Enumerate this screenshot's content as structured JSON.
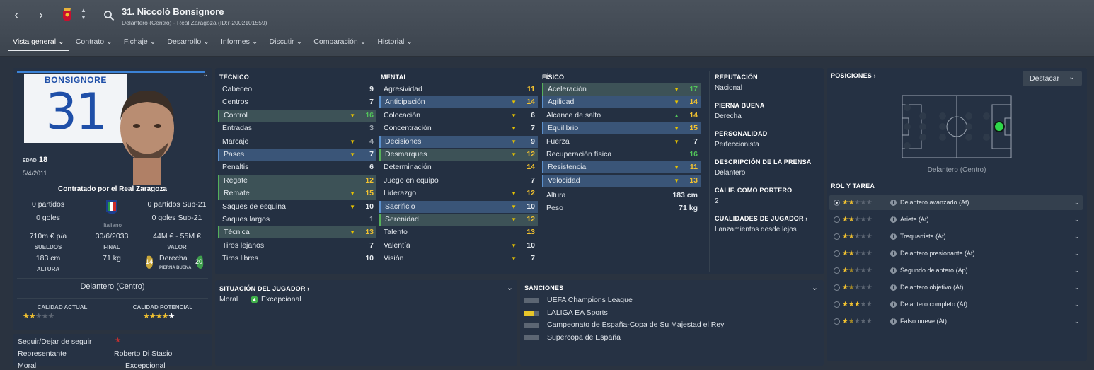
{
  "header": {
    "title": "31. Niccolò Bonsignore",
    "subtitle": "Delantero (Centro) - Real Zaragoza (ID:r-2002101559)",
    "back_glyph": "‹",
    "forward_glyph": "›"
  },
  "tabs": [
    {
      "label": "Vista general ⌄"
    },
    {
      "label": "Contrato ⌄"
    },
    {
      "label": "Fichaje ⌄"
    },
    {
      "label": "Desarrollo ⌄"
    },
    {
      "label": "Informes ⌄"
    },
    {
      "label": "Discutir ⌄"
    },
    {
      "label": "Comparación ⌄"
    },
    {
      "label": "Historial ⌄"
    }
  ],
  "profile": {
    "shirt_name": "BONSIGNORE",
    "shirt_number": "31",
    "age_label": "EDAD",
    "age": "18",
    "dob": "5/4/2011",
    "contracted_by": "Contratado por el Real Zaragoza",
    "apps": "0 partidos",
    "goals": "0 goles",
    "apps_u21": "0 partidos Sub-21",
    "goals_u21": "0 goles Sub-21",
    "nationality": "Italiano",
    "wage": "710m € p/a",
    "wage_label": "SUELDOS",
    "contract_end": "30/6/2033",
    "contract_end_label": "FINAL",
    "value": "44M € - 55M €",
    "value_label": "VALOR",
    "height": "183 cm",
    "height_label": "ALTURA",
    "weight": "71 kg",
    "foot": "Derecha",
    "foot_label": "PIERNA BUENA",
    "left_foot_rating": "14",
    "right_foot_rating": "20",
    "position": "Delantero (Centro)",
    "current_ability_label": "CALIDAD ACTUAL",
    "current_ability_stars": 2,
    "potential_ability_label": "CALIDAD POTENCIAL",
    "potential_ability_stars": 4,
    "star_glyphs": {
      "c": "★★☆☆☆",
      "p": "★★★★★"
    }
  },
  "extra": {
    "follow": "Seguir/Dejar de seguir",
    "follow_mark": "★",
    "agent_label": "Representante",
    "agent": "Roberto Di Stasio",
    "morale_label": "Moral",
    "morale": "Excepcional"
  },
  "attributes": {
    "tecnico_label": "TÉCNICO",
    "mental_label": "MENTAL",
    "fisico_label": "FÍSICO",
    "tecnico": [
      {
        "name": "Cabeceo",
        "value": "9",
        "arrow": ""
      },
      {
        "name": "Centros",
        "value": "7",
        "arrow": ""
      },
      {
        "name": "Control",
        "value": "16",
        "arrow": "▼"
      },
      {
        "name": "Entradas",
        "value": "3",
        "arrow": ""
      },
      {
        "name": "Marcaje",
        "value": "4",
        "arrow": "▼"
      },
      {
        "name": "Pases",
        "value": "7",
        "arrow": "▼"
      },
      {
        "name": "Penaltis",
        "value": "6",
        "arrow": ""
      },
      {
        "name": "Regate",
        "value": "12",
        "arrow": ""
      },
      {
        "name": "Remate",
        "value": "15",
        "arrow": "▼"
      },
      {
        "name": "Saques de esquina",
        "value": "10",
        "arrow": "▼"
      },
      {
        "name": "Saques largos",
        "value": "1",
        "arrow": ""
      },
      {
        "name": "Técnica",
        "value": "13",
        "arrow": "▼"
      },
      {
        "name": "Tiros lejanos",
        "value": "7",
        "arrow": ""
      },
      {
        "name": "Tiros libres",
        "value": "10",
        "arrow": ""
      }
    ],
    "mental": [
      {
        "name": "Agresividad",
        "value": "11",
        "arrow": ""
      },
      {
        "name": "Anticipación",
        "value": "14",
        "arrow": "▼"
      },
      {
        "name": "Colocación",
        "value": "6",
        "arrow": "▼"
      },
      {
        "name": "Concentración",
        "value": "7",
        "arrow": "▼"
      },
      {
        "name": "Decisiones",
        "value": "9",
        "arrow": "▼"
      },
      {
        "name": "Desmarques",
        "value": "12",
        "arrow": "▼"
      },
      {
        "name": "Determinación",
        "value": "14",
        "arrow": ""
      },
      {
        "name": "Juego en equipo",
        "value": "7",
        "arrow": ""
      },
      {
        "name": "Liderazgo",
        "value": "12",
        "arrow": "▼"
      },
      {
        "name": "Sacrificio",
        "value": "10",
        "arrow": "▼"
      },
      {
        "name": "Serenidad",
        "value": "12",
        "arrow": "▼"
      },
      {
        "name": "Talento",
        "value": "13",
        "arrow": ""
      },
      {
        "name": "Valentía",
        "value": "10",
        "arrow": "▼"
      },
      {
        "name": "Visión",
        "value": "7",
        "arrow": "▼"
      }
    ],
    "fisico": [
      {
        "name": "Aceleración",
        "value": "17",
        "arrow": "▼"
      },
      {
        "name": "Agilidad",
        "value": "14",
        "arrow": "▼"
      },
      {
        "name": "Alcance de salto",
        "value": "14",
        "arrow": "▲"
      },
      {
        "name": "Equilibrio",
        "value": "15",
        "arrow": "▼"
      },
      {
        "name": "Fuerza",
        "value": "7",
        "arrow": "▼"
      },
      {
        "name": "Recuperación física",
        "value": "16",
        "arrow": ""
      },
      {
        "name": "Resistencia",
        "value": "11",
        "arrow": "▼"
      },
      {
        "name": "Velocidad",
        "value": "13",
        "arrow": "▼"
      }
    ],
    "altura_label": "Altura",
    "altura": "183 cm",
    "peso_label": "Peso",
    "peso": "71 kg"
  },
  "info": {
    "reputation_label": "REPUTACIÓN",
    "reputation": "Nacional",
    "foot_label": "PIERNA BUENA",
    "foot": "Derecha",
    "personality_label": "PERSONALIDAD",
    "personality": "Perfeccionista",
    "press_label": "DESCRIPCIÓN DE LA PRENSA",
    "press": "Delantero",
    "gk_label": "CALIF. COMO PORTERO",
    "gk": "2",
    "traits_label": "CUALIDADES DE JUGADOR ›",
    "traits": "Lanzamientos desde lejos"
  },
  "status": {
    "label": "SITUACIÓN DEL JUGADOR ›",
    "morale_label": "Moral",
    "morale": "Excepcional"
  },
  "sanctions": {
    "label": "SANCIONES",
    "items": [
      {
        "name": "UEFA Champions League",
        "yellow": 0
      },
      {
        "name": "LALIGA EA Sports",
        "yellow": 2
      },
      {
        "name": "Campeonato de España-Copa de Su Majestad el Rey",
        "yellow": 0
      },
      {
        "name": "Supercopa de España",
        "yellow": 0
      }
    ]
  },
  "positions": {
    "label": "POSICIONES ›",
    "highlight_button": "Destacar",
    "position_name": "Delantero (Centro)",
    "role_label": "ROL Y TAREA",
    "roles": [
      {
        "name": "Delantero avanzado (At)",
        "stars": "★★☆☆☆",
        "selected": true
      },
      {
        "name": "Ariete (At)",
        "stars": "★★☆☆☆",
        "selected": false
      },
      {
        "name": "Trequartista (At)",
        "stars": "★★☆☆☆",
        "selected": false
      },
      {
        "name": "Delantero presionante (At)",
        "stars": "★★☆☆☆",
        "selected": false
      },
      {
        "name": "Segundo delantero (Ap)",
        "stars": "★½☆☆☆",
        "selected": false
      },
      {
        "name": "Delantero objetivo (At)",
        "stars": "★½☆☆☆",
        "selected": false
      },
      {
        "name": "Delantero completo (At)",
        "stars": "★★★☆☆",
        "selected": false
      },
      {
        "name": "Falso nueve (At)",
        "stars": "★½☆☆☆",
        "selected": false
      }
    ]
  },
  "colors": {
    "accent": "#3b82d6",
    "highlight_green": "#3d5257",
    "highlight_blue": "#3a5578",
    "arrow_yellow": "#e6c200",
    "green_value": "#52c45a"
  }
}
